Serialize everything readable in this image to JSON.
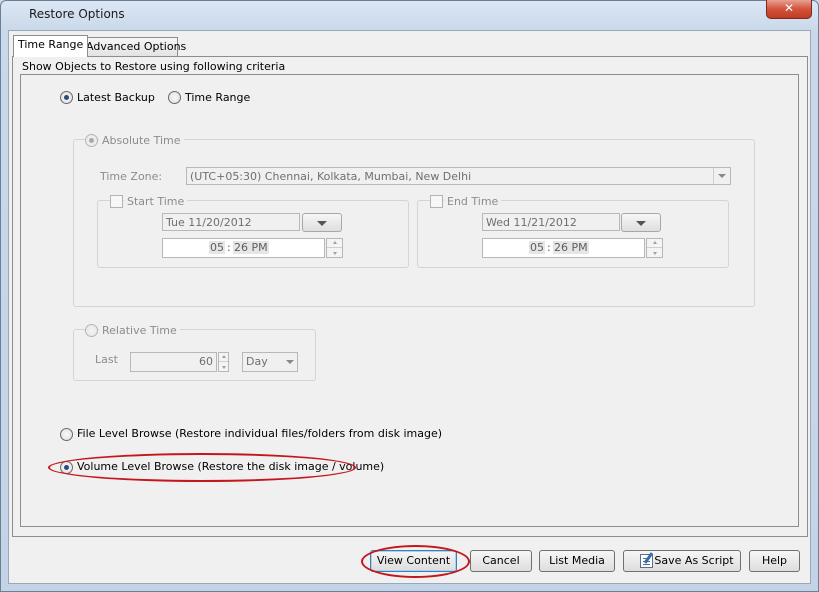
{
  "window": {
    "title": "Restore Options",
    "close_glyph": "✕"
  },
  "tabs": [
    {
      "label": "Time Range",
      "selected": true
    },
    {
      "label": "Advanced Options",
      "selected": false
    }
  ],
  "criteria_label": "Show Objects to Restore using following criteria",
  "options": {
    "latest_backup": {
      "label": "Latest Backup",
      "checked": true
    },
    "time_range": {
      "label": "Time Range",
      "checked": false
    }
  },
  "absolute_time": {
    "label": "Absolute Time",
    "time_zone_label": "Time Zone:",
    "time_zone_value": "(UTC+05:30) Chennai, Kolkata, Mumbai, New Delhi",
    "start": {
      "label": "Start Time",
      "date": "Tue 11/20/2012",
      "hour": "05",
      "separator": ":",
      "minute_ampm": "26 PM"
    },
    "end": {
      "label": "End Time",
      "date": "Wed 11/21/2012",
      "hour": "05",
      "separator": ":",
      "minute_ampm": "26 PM"
    }
  },
  "relative_time": {
    "label": "Relative Time",
    "last_label": "Last",
    "last_value": "60",
    "unit": "Day"
  },
  "browse": {
    "file_level": {
      "label": "File Level Browse (Restore individual files/folders from disk image)",
      "checked": false
    },
    "volume_level": {
      "label": "Volume Level Browse (Restore the disk image / volume)",
      "checked": true
    }
  },
  "buttons": {
    "view_content": "View Content",
    "cancel": "Cancel",
    "list_media": "List Media",
    "save_as_script": "Save As Script",
    "help": "Help"
  },
  "colors": {
    "highlight_ellipse": "#c4161c",
    "radio_dot": "#2b4a80",
    "disabled_text": "#8c8c8c"
  },
  "icons": {
    "save_script": "script-pencil-icon",
    "close": "close-icon",
    "dropdown": "chevron-down-icon"
  }
}
